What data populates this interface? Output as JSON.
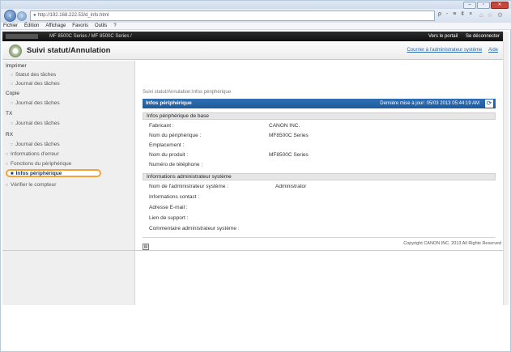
{
  "browser": {
    "url": "http://192.168.222.53/d_info.html",
    "search_hint": "ρ - ≡ ¢ ×",
    "menu": [
      "Fichier",
      "Édition",
      "Affichage",
      "Favoris",
      "Outils",
      "?"
    ]
  },
  "device_bar": {
    "title": "MF 8500C Series / MF 8500C Series /",
    "link_portal": "Vers le portail",
    "link_logout": "Se déconnecter"
  },
  "header": {
    "title": "Suivi statut/Annulation",
    "link_admin": "Courrier à l'administrateur système",
    "link_help": "Aide"
  },
  "sidebar": {
    "cat_print": "Imprimer",
    "print_status": "Statut des tâches",
    "print_log": "Journal des tâches",
    "cat_copy": "Copie",
    "copy_log": "Journal des tâches",
    "cat_tx": "TX",
    "tx_log": "Journal des tâches",
    "cat_rx": "RX",
    "rx_log": "Journal des tâches",
    "error_info": "Informations d'erreur",
    "device_functions": "Fonctions du périphérique",
    "device_info": "Infos périphérique",
    "check_counter": "Vérifier le compteur"
  },
  "main": {
    "breadcrumb": "Suivi statut/Annulation:Infos périphérique",
    "panel_title": "Infos périphérique",
    "last_update": "Dernière mise à jour: 05/03 2013 05:44:19 AM",
    "section_basic": "Infos périphérique de base",
    "manufacturer_label": "Fabricant :",
    "manufacturer_value": "CANON INC.",
    "device_name_label": "Nom du périphérique :",
    "device_name_value": "MF8500C Series",
    "location_label": "Emplacement :",
    "product_name_label": "Nom du produit :",
    "product_name_value": "MF8500C Series",
    "phone_label": "Numéro de téléphone :",
    "section_admin": "Informations administrateur système",
    "admin_name_label": "Nom de l'administrateur système :",
    "admin_name_value": "Administrator",
    "contact_label": "Informations contact :",
    "email_label": "Adresse E-mail :",
    "support_label": "Lien de support :",
    "comment_label": "Commentaire administrateur système :"
  },
  "footer": {
    "copyright": "Copyright CANON INC. 2013 All Rights Reserved"
  }
}
